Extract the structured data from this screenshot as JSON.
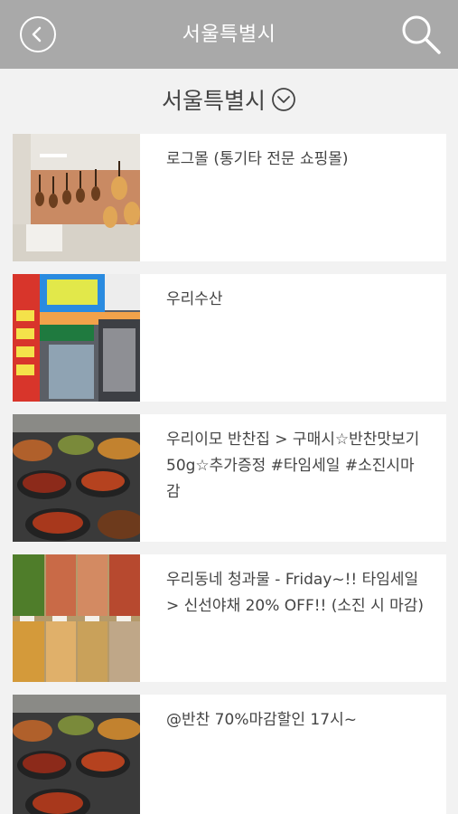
{
  "header": {
    "title": "서울특별시",
    "back_icon": "chevron-left-circle-icon",
    "search_icon": "search-icon"
  },
  "region_selector": {
    "label": "서울특별시",
    "icon": "chevron-down-circle-icon"
  },
  "items": [
    {
      "title": "로그몰 (통기타 전문 쇼핑몰)",
      "thumbnail": "guitar-shop-photo"
    },
    {
      "title": "우리수산",
      "thumbnail": "storefront-photo"
    },
    {
      "title": "우리이모 반찬집 > 구매시☆반찬맛보기50g☆추가증정 #타임세일 #소진시마감",
      "thumbnail": "side-dish-photo"
    },
    {
      "title": "우리동네 청과물 - Friday~!! 타임세일 > 신선야채 20% OFF!! (소진 시 마감)",
      "thumbnail": "vegetable-market-photo"
    },
    {
      "title": "@반찬 70%마감할인 17시~",
      "thumbnail": "side-dish-photo"
    }
  ],
  "colors": {
    "header_bg": "#a9a9a9",
    "page_bg": "#f2f2f2",
    "card_bg": "#ffffff"
  }
}
